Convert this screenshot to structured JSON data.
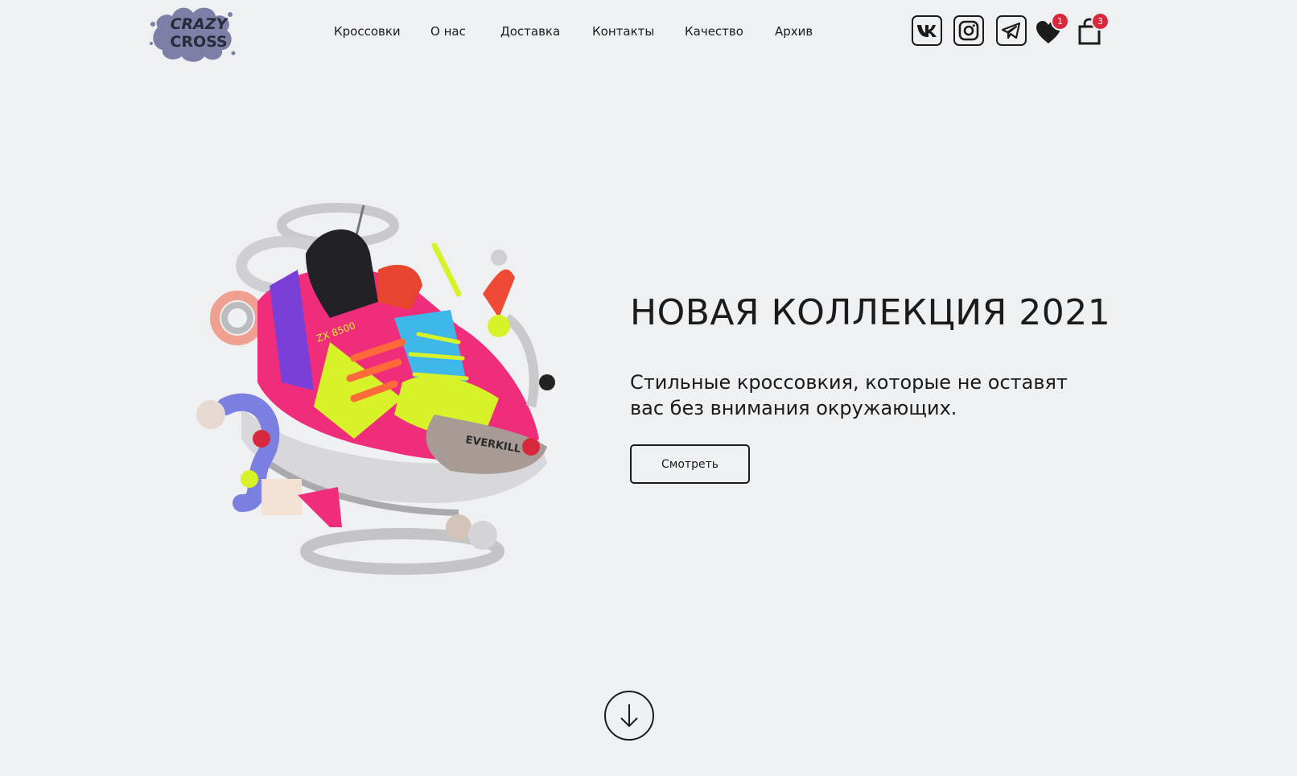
{
  "brand": {
    "logo_line1": "CRAZY",
    "logo_line2": "CROSS",
    "logo_splash_color": "#7d7fa6"
  },
  "nav": {
    "items": [
      {
        "label": "Кроссовки"
      },
      {
        "label": "О нас"
      },
      {
        "label": "Доставка"
      },
      {
        "label": "Контакты"
      },
      {
        "label": "Качество"
      },
      {
        "label": "Архив"
      }
    ]
  },
  "header_icons": {
    "vk": {
      "icon": "vk-icon"
    },
    "instagram": {
      "icon": "instagram-icon"
    },
    "telegram": {
      "icon": "telegram-icon"
    },
    "favorites": {
      "icon": "heart-icon",
      "count": "1"
    },
    "cart": {
      "icon": "shopping-bag-icon",
      "count": "3"
    }
  },
  "hero": {
    "title": "НОВАЯ КОЛЛЕКЦИЯ 2021",
    "subtitle": "Стильные кроссовкия, которые не оставят вас без внимания окружающих.",
    "button_label": "Смотреть",
    "image": "sneaker-collage-image",
    "sneaker_text_1": "ZX 8500",
    "sneaker_text_2": "EVERKILL"
  },
  "scroll": {
    "icon": "arrow-down-icon"
  },
  "colors": {
    "background": "#eff0f2",
    "text": "#1b1b1b",
    "badge": "#d8293c",
    "accent_pink": "#ef2d7a",
    "accent_lime": "#d8f22a",
    "accent_purple": "#7a3fd6"
  }
}
